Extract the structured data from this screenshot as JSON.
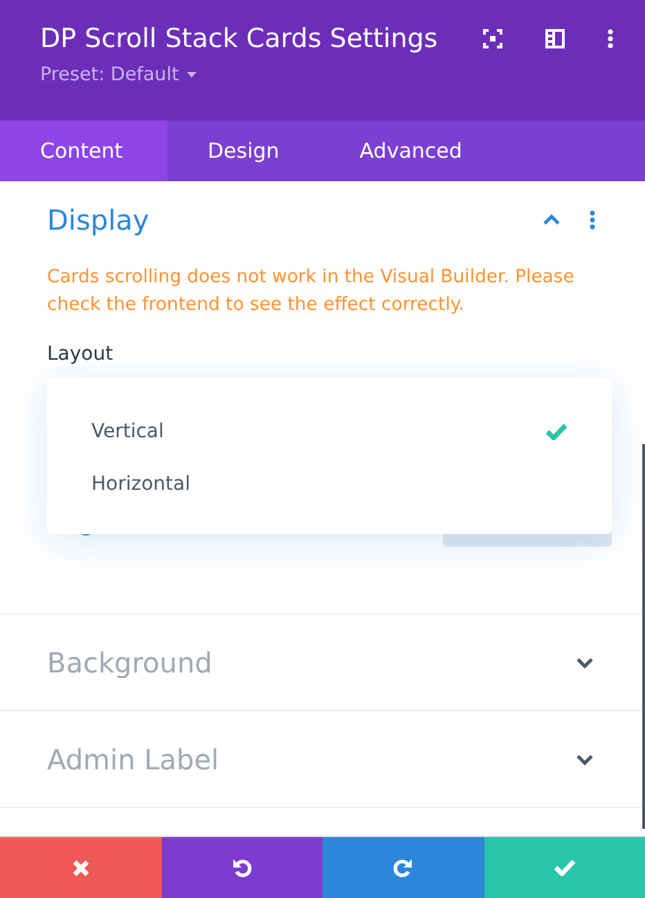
{
  "header": {
    "title": "DP Scroll Stack Cards Settings",
    "preset": "Preset: Default"
  },
  "tabs": [
    {
      "label": "Content",
      "selected": true
    },
    {
      "label": "Design",
      "selected": false
    },
    {
      "label": "Advanced",
      "selected": false
    }
  ],
  "sections": [
    {
      "title": "Display",
      "expanded": true,
      "warning": "Cards scrolling does not work in the Visual Builder. Please check the frontend to see the effect correctly.",
      "field_label": "Layout",
      "dropdown": {
        "options": [
          {
            "label": "Vertical",
            "selected": true
          },
          {
            "label": "Horizontal",
            "selected": false
          }
        ]
      }
    },
    {
      "title": "Background",
      "expanded": false
    },
    {
      "title": "Admin Label",
      "expanded": false
    }
  ],
  "footer": [
    {
      "kind": "cancel"
    },
    {
      "kind": "undo"
    },
    {
      "kind": "redo"
    },
    {
      "kind": "save"
    }
  ]
}
